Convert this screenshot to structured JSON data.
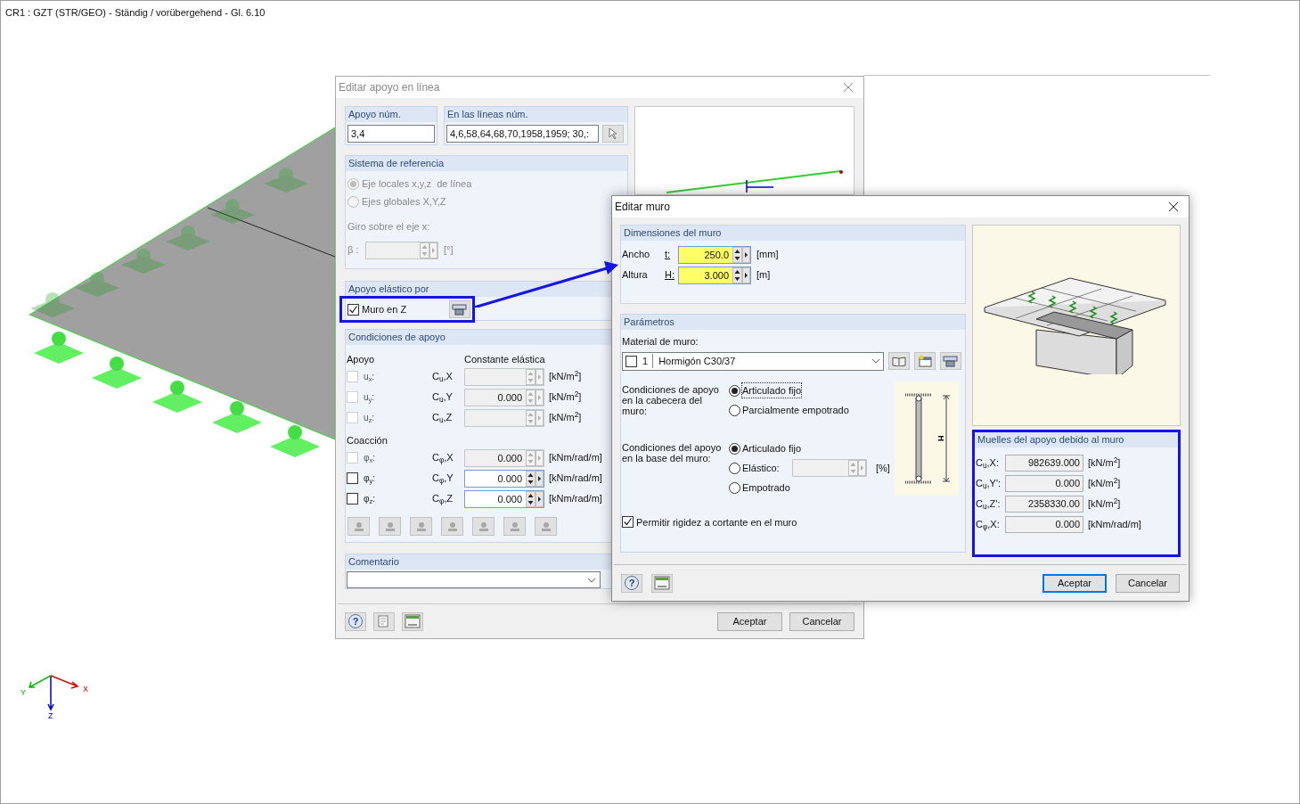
{
  "viewport": {
    "title": "CR1 : GZT (STR/GEO) - Ständig / vorübergehend - Gl. 6.10",
    "axes": {
      "x": "X",
      "y": "Y",
      "z": "Z"
    }
  },
  "support_dialog": {
    "title": "Editar apoyo en línea",
    "support_no": {
      "label": "Apoyo núm.",
      "value": "3,4"
    },
    "lines_no": {
      "label": "En las líneas núm.",
      "value": "4,6,58,64,68,70,1958,1959; 30,:"
    },
    "reference": {
      "title": "Sistema de referencia",
      "disabled": true,
      "options": [
        {
          "label": "Eje locales x,y,z  de línea",
          "selected": true
        },
        {
          "label": "Ejes globales X,Y,Z",
          "selected": false
        }
      ],
      "rotation_label": "Giro sobre el eje x:",
      "beta_label": "β :",
      "beta_unit": "[°]"
    },
    "elastic": {
      "title": "Apoyo elástico por",
      "label": "Muro en Z",
      "checked": true
    },
    "conditions": {
      "title": "Condiciones de apoyo",
      "col_support": "Apoyo",
      "col_constant": "Constante elástica",
      "restraint_title": "Coacción",
      "support_rows": [
        {
          "label": "u$_{x}$:",
          "symbol": "C$_{u}$,X",
          "unit": "[kN/m$^{2}$]",
          "checked": false,
          "disabled": true
        },
        {
          "label": "u$_{y}$:",
          "symbol": "C$_{u}$,Y",
          "value": "0.000",
          "unit": "[kN/m$^{2}$]",
          "checked": false,
          "disabled": true
        },
        {
          "label": "u$_{z}$:",
          "symbol": "C$_{u}$,Z",
          "unit": "[kN/m$^{2}$]",
          "checked": false,
          "disabled": true
        }
      ],
      "restraint_rows": [
        {
          "label": "φ$_{x}$:",
          "symbol": "C$_{φ}$,X",
          "value": "0.000",
          "unit": "[kNm/rad/m]",
          "checked": false,
          "disabled": true
        },
        {
          "label": "φ$_{y}$:",
          "symbol": "C$_{φ}$,Y",
          "value": "0.000",
          "unit": "[kNm/rad/m]",
          "checked": false,
          "disabled": false
        },
        {
          "label": "φ$_{z}$:",
          "symbol": "C$_{φ}$,Z",
          "value": "0.000",
          "unit": "[kNm/rad/m]",
          "checked": false,
          "disabled": false
        }
      ]
    },
    "comment": {
      "title": "Comentario"
    },
    "help_glyph": "?",
    "buttons": [
      "Aceptar",
      "Cancelar"
    ]
  },
  "wall_dialog": {
    "title": "Editar muro",
    "dimensions": {
      "title": "Dimensiones del muro",
      "rows": [
        {
          "label": "Ancho",
          "symbol": "t:",
          "value": "250.0",
          "unit": "[mm]",
          "highlighted": true
        },
        {
          "label": "Altura",
          "symbol": "H:",
          "value": "3.000",
          "unit": "[m]",
          "highlighted": true
        }
      ]
    },
    "parameters": {
      "title": "Parámetros",
      "material_label": "Material de muro:",
      "material_number": "1",
      "material_name": "Hormigón C30/37",
      "head": {
        "label": "Condiciones de apoyo en la cabecera del muro:",
        "options": [
          {
            "label": "Articulado fijo",
            "selected": true,
            "kind": "plain"
          },
          {
            "label": "Parcialmente empotrado",
            "selected": false,
            "kind": "plain"
          }
        ]
      },
      "base": {
        "label": "Condiciones del apoyo en la base del muro:",
        "options": [
          {
            "label": "Articulado fijo",
            "selected": true,
            "kind": "plain"
          },
          {
            "label": "Elástico:",
            "selected": false,
            "kind": "input",
            "unit": "[%]"
          },
          {
            "label": "Empotrado",
            "selected": false,
            "kind": "plain"
          }
        ]
      },
      "diagram_label": "H",
      "shear": {
        "label": "Permitir rigidez a cortante en el muro",
        "checked": true
      }
    },
    "springs": {
      "title": "Muelles del apoyo debido al muro",
      "rows": [
        {
          "symbol": "C$_{u}$,X:",
          "value": "982639.000",
          "unit": "[kN/m$^{2}$]"
        },
        {
          "symbol": "C$_{u}$,Y':",
          "value": "0.000",
          "unit": "[kN/m$^{2}$]"
        },
        {
          "symbol": "C$_{u}$,Z':",
          "value": "2358330.00",
          "unit": "[kN/m$^{2}$]"
        },
        {
          "symbol": "C$_{φ}$,X:",
          "value": "0.000",
          "unit": "[kNm/rad/m]"
        }
      ]
    },
    "help_glyph": "?",
    "buttons": [
      "Aceptar",
      "Cancelar"
    ]
  }
}
